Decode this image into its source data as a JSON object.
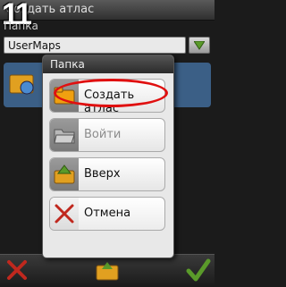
{
  "window": {
    "title": "Создать атлас"
  },
  "annotation": {
    "step_number": "11"
  },
  "form": {
    "folder_label": "Папка",
    "folder_value": "UserMaps"
  },
  "dialog": {
    "title": "Папка",
    "items": [
      {
        "label": "Создать атлас",
        "icon": "folder-new-icon",
        "enabled": true,
        "highlighted": true
      },
      {
        "label": "Войти",
        "icon": "folder-open-icon",
        "enabled": false
      },
      {
        "label": "Вверх",
        "icon": "folder-up-icon",
        "enabled": true
      },
      {
        "label": "Отмена",
        "icon": "cancel-x-icon",
        "enabled": true
      }
    ]
  },
  "bottom_bar": {
    "left": "cancel-icon",
    "center": "folder-up-icon",
    "right": "ok-check-icon"
  },
  "colors": {
    "accent_green": "#5a9a2a",
    "cancel_red": "#c0281e",
    "highlight_red": "#e01010",
    "list_blue": "#3b5f86"
  }
}
